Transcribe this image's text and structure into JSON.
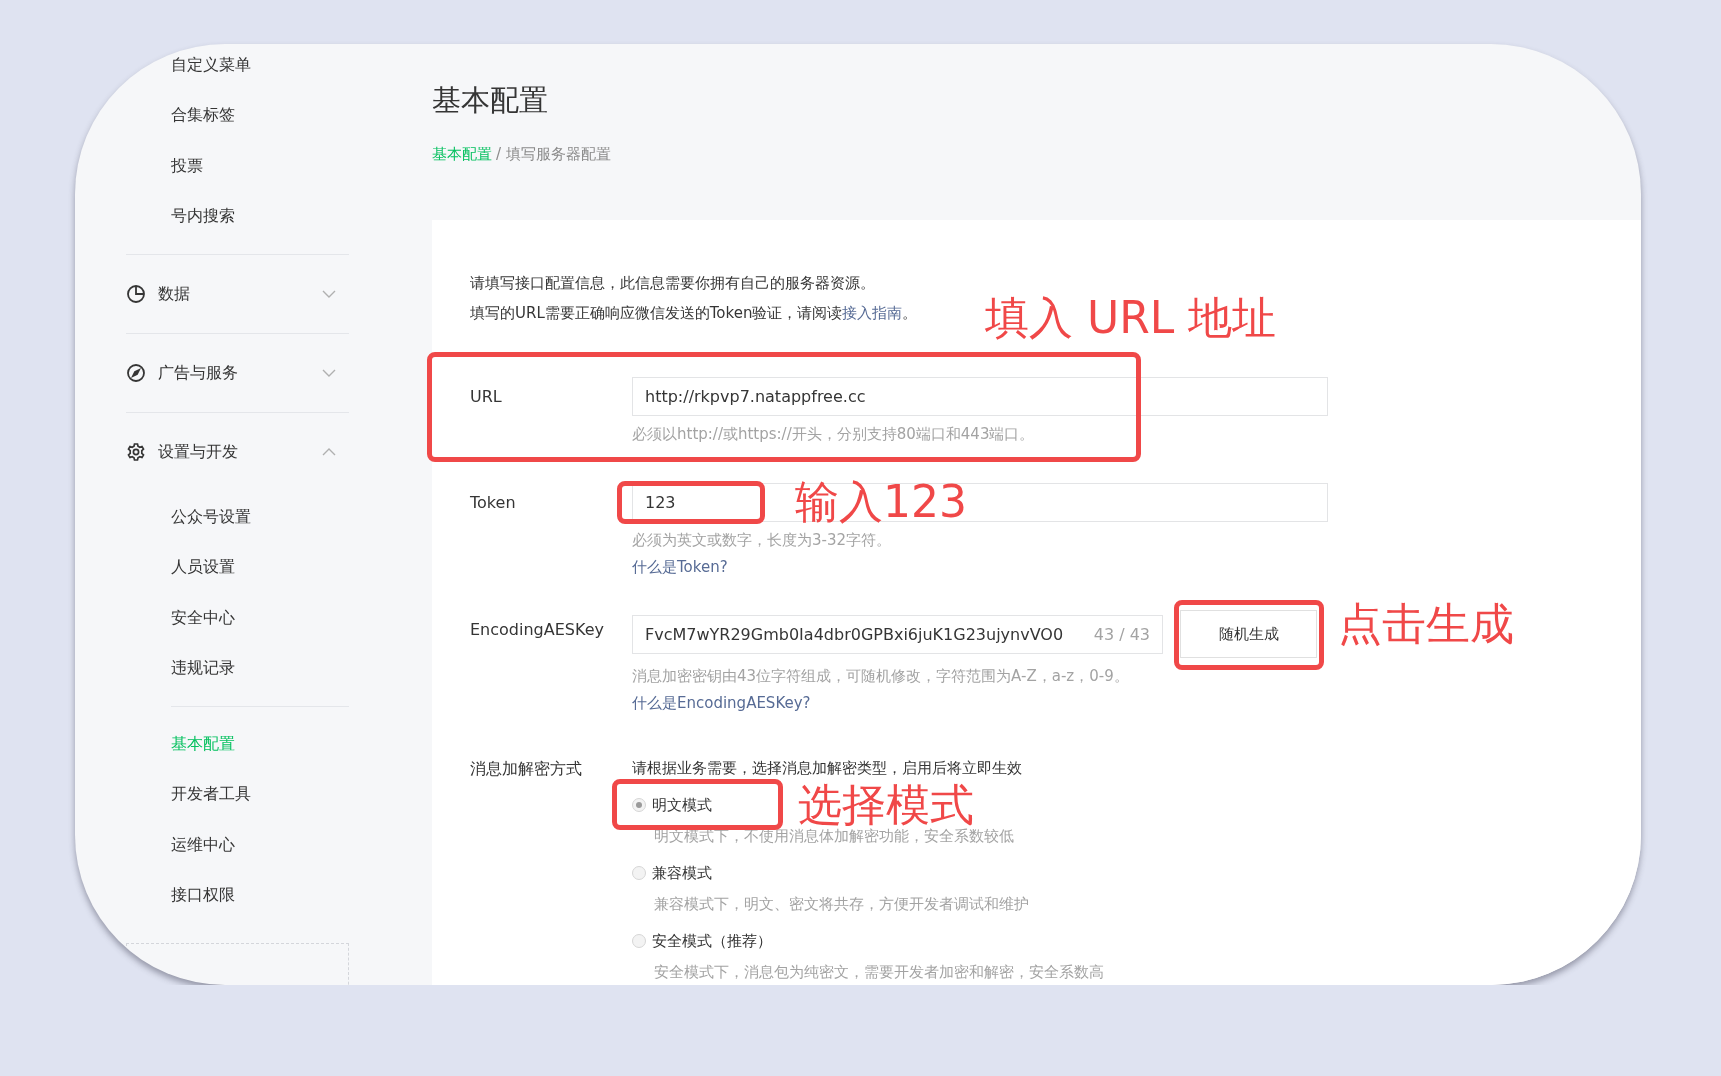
{
  "sidebar": {
    "items": [
      {
        "label": "自定义菜单",
        "selected": false
      },
      {
        "label": "合集标签",
        "selected": false
      },
      {
        "label": "投票",
        "selected": false
      },
      {
        "label": "号内搜索",
        "selected": false
      }
    ],
    "groups": [
      {
        "label": "数据",
        "kind": "chart",
        "expanded": false
      },
      {
        "label": "广告与服务",
        "kind": "compass",
        "expanded": false
      },
      {
        "label": "设置与开发",
        "kind": "gear",
        "expanded": true,
        "items": [
          {
            "label": "公众号设置",
            "selected": false
          },
          {
            "label": "人员设置",
            "selected": false
          },
          {
            "label": "安全中心",
            "selected": false
          },
          {
            "label": "违规记录",
            "selected": false
          },
          {
            "label": "基本配置",
            "selected": true
          },
          {
            "label": "开发者工具",
            "selected": false
          },
          {
            "label": "运维中心",
            "selected": false
          },
          {
            "label": "接口权限",
            "selected": false
          }
        ]
      }
    ]
  },
  "page": {
    "title": "基本配置",
    "breadcrumb": [
      {
        "label": "基本配置",
        "link": true
      },
      {
        "label": "/ 填写服务器配置",
        "link": false
      }
    ]
  },
  "intro": {
    "line_1": "请填写接口配置信息，此信息需要你拥有自己的服务器资源。",
    "line_2": "填写的URL需要正确响应微信发送的Token验证，请阅读",
    "link": "接入指南",
    "end": "。"
  },
  "fields": [
    {
      "label": "URL",
      "value": "http://rkpvp7.natappfree.cc",
      "hint": "必须以http://或https://开头，分别支持80端口和443端口。"
    },
    {
      "label": "Token",
      "value": "123",
      "hint": "必须为英文或数字，长度为3-32字符。",
      "link": "什么是Token?"
    },
    {
      "label": "EncodingAESKey",
      "value": "FvcM7wYR29Gmb0Ia4dbr0GPBxi6juK1G23ujynvVO0",
      "counter": "43 / 43",
      "button": "随机生成",
      "hint": "消息加密密钥由43位字符组成，可随机修改，字符范围为A-Z，a-z，0-9。",
      "link": "什么是EncodingAESKey?"
    }
  ],
  "encryption": {
    "label": "消息加解密方式",
    "description": "请根据业务需要，选择消息加解密类型，启用后将立即生效",
    "modes": [
      {
        "label": "明文模式",
        "selected": true,
        "hint": "明文模式下，不使用消息体加解密功能，安全系数较低"
      },
      {
        "label": "兼容模式",
        "selected": false,
        "hint": "兼容模式下，明文、密文将共存，方便开发者调试和维护"
      },
      {
        "label": "安全模式（推荐）",
        "selected": false,
        "hint": "安全模式下，消息包为纯密文，需要开发者加密和解密，安全系数高"
      }
    ]
  },
  "annotations": [
    {
      "text": "填入 URL 地址"
    },
    {
      "text": "输入123"
    },
    {
      "text": "点击生成"
    },
    {
      "text": "选择模式"
    }
  ]
}
